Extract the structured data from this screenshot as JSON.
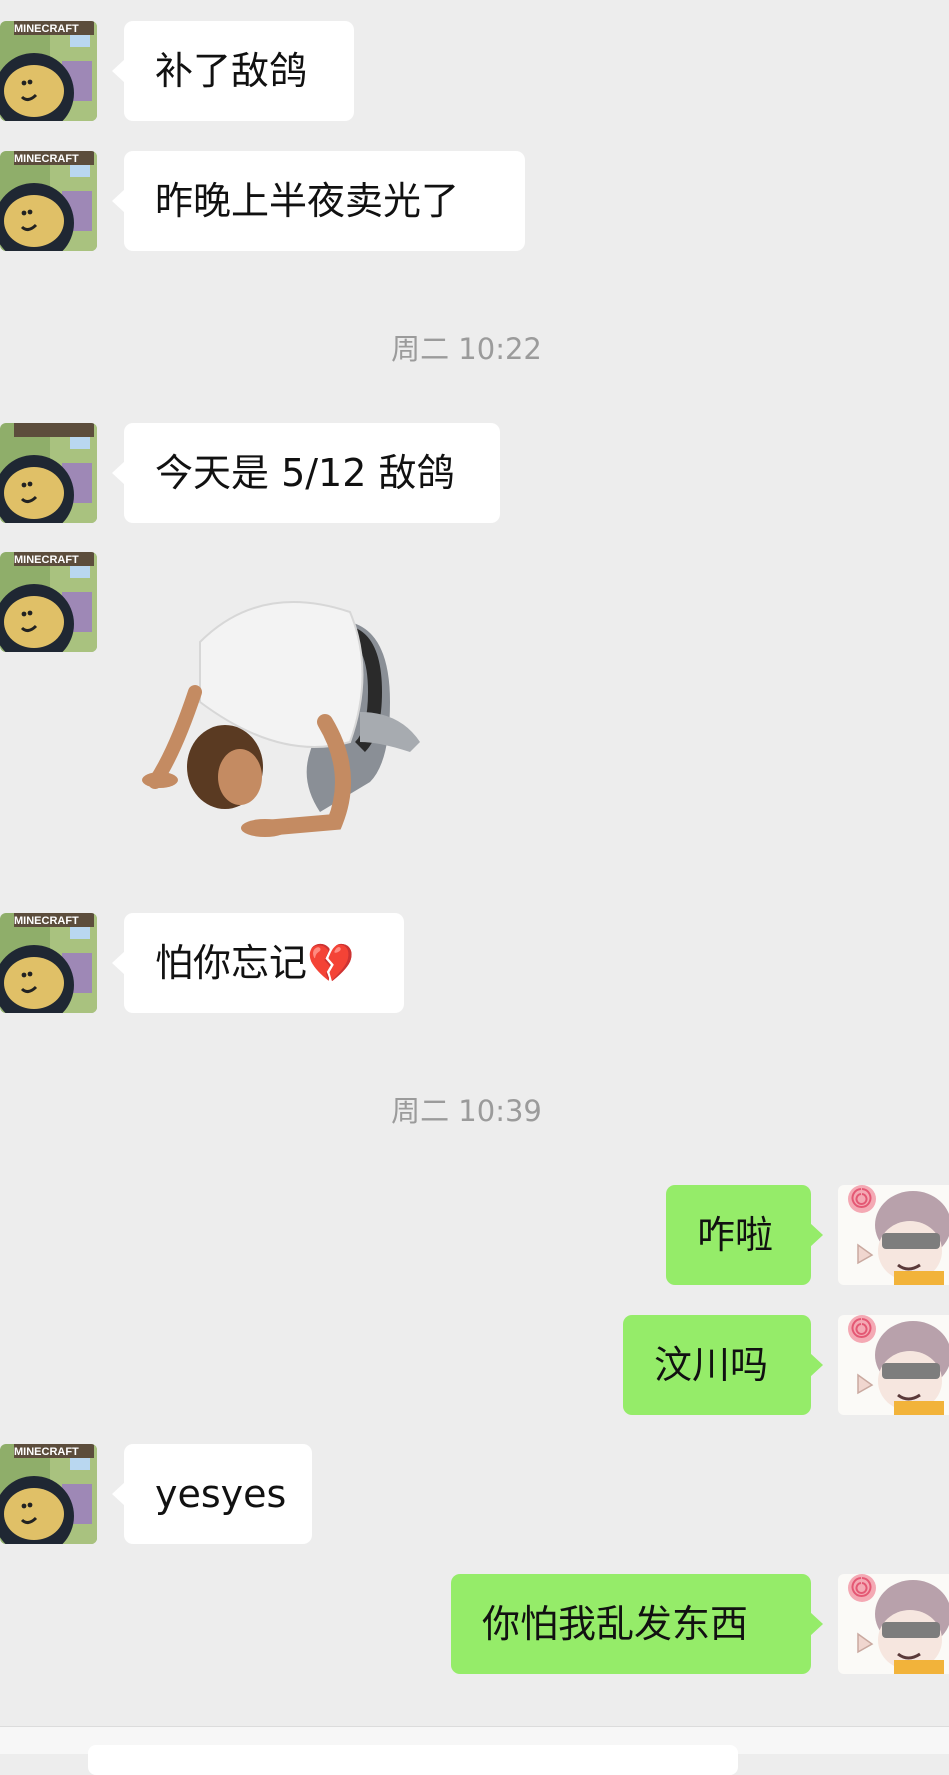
{
  "timestamps": [
    "周二 10:22",
    "周二 10:39"
  ],
  "messages": [
    {
      "side": "in",
      "text": "补了敌鸽"
    },
    {
      "side": "in",
      "text": "昨晚上半夜卖光了"
    },
    {
      "side": "in",
      "text": "今天是 5/12 敌鸽"
    },
    {
      "side": "in",
      "sticker": "kneeling-bowing-man-sticker"
    },
    {
      "side": "in",
      "text": "怕你忘记💔"
    },
    {
      "side": "out",
      "text": "咋啦"
    },
    {
      "side": "out",
      "text": "汶川吗"
    },
    {
      "side": "in",
      "text": "yesyes"
    },
    {
      "side": "out",
      "text": "你怕我乱发东西"
    }
  ],
  "avatars": {
    "contact": {
      "description_icon": "minecraft-hooded-character-avatar",
      "logo_text": "MINECRAFT"
    },
    "self": {
      "description_icon": "anime-girl-lollipop-avatar"
    }
  },
  "colors": {
    "background": "#ededed",
    "incoming_bubble": "#ffffff",
    "outgoing_bubble": "#95ec69",
    "timestamp": "#9b9b9b"
  }
}
